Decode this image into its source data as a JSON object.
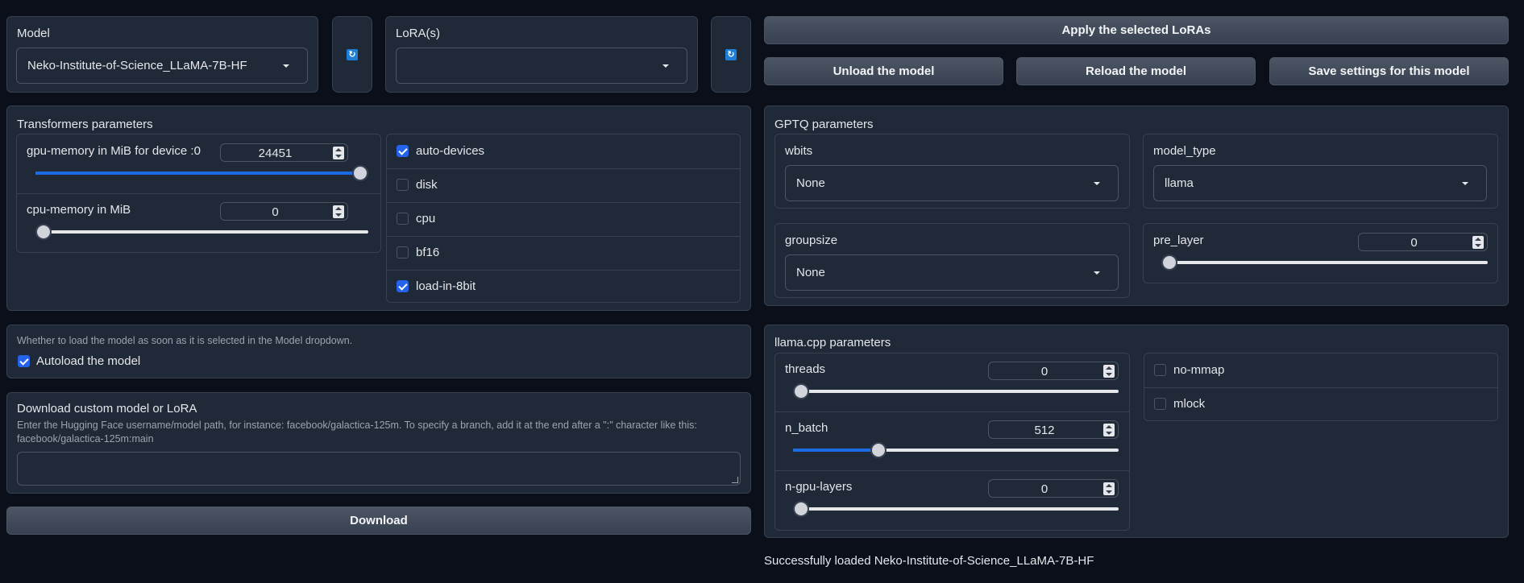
{
  "model": {
    "label": "Model",
    "selected": "Neko-Institute-of-Science_LLaMA-7B-HF",
    "refresh_icon": "refresh-icon"
  },
  "lora": {
    "label": "LoRA(s)",
    "selected": "",
    "refresh_icon": "refresh-icon"
  },
  "buttons": {
    "apply_loras": "Apply the selected LoRAs",
    "unload": "Unload the model",
    "reload": "Reload the model",
    "save_settings": "Save settings for this model",
    "download": "Download"
  },
  "transformers": {
    "title": "Transformers parameters",
    "gpu_memory": {
      "label": "gpu-memory in MiB for device :0",
      "value": "24451",
      "fraction": 1.0
    },
    "cpu_memory": {
      "label": "cpu-memory in MiB",
      "value": "0",
      "fraction": 0.0
    },
    "checkboxes": [
      {
        "label": "auto-devices",
        "checked": true
      },
      {
        "label": "disk",
        "checked": false
      },
      {
        "label": "cpu",
        "checked": false
      },
      {
        "label": "bf16",
        "checked": false
      },
      {
        "label": "load-in-8bit",
        "checked": true
      }
    ]
  },
  "gptq": {
    "title": "GPTQ parameters",
    "wbits": {
      "label": "wbits",
      "value": "None"
    },
    "model_type": {
      "label": "model_type",
      "value": "llama"
    },
    "groupsize": {
      "label": "groupsize",
      "value": "None"
    },
    "pre_layer": {
      "label": "pre_layer",
      "value": "0",
      "fraction": 0.0
    }
  },
  "autoload": {
    "info": "Whether to load the model as soon as it is selected in the Model dropdown.",
    "label": "Autoload the model",
    "checked": true
  },
  "download": {
    "title": "Download custom model or LoRA",
    "info": "Enter the Hugging Face username/model path, for instance: facebook/galactica-125m. To specify a branch, add it at the end after a \":\" character like this: facebook/galactica-125m:main",
    "value": ""
  },
  "llamacpp": {
    "title": "llama.cpp parameters",
    "threads": {
      "label": "threads",
      "value": "0",
      "fraction": 0.0
    },
    "n_batch": {
      "label": "n_batch",
      "value": "512",
      "fraction": 0.25
    },
    "n_gpu_layers": {
      "label": "n-gpu-layers",
      "value": "0",
      "fraction": 0.0
    },
    "checkboxes": [
      {
        "label": "no-mmap",
        "checked": false
      },
      {
        "label": "mlock",
        "checked": false
      }
    ]
  },
  "status": "Successfully loaded Neko-Institute-of-Science_LLaMA-7B-HF",
  "colors": {
    "background": "#0b0f19",
    "panel": "#1f2937",
    "accent": "#2563eb"
  }
}
